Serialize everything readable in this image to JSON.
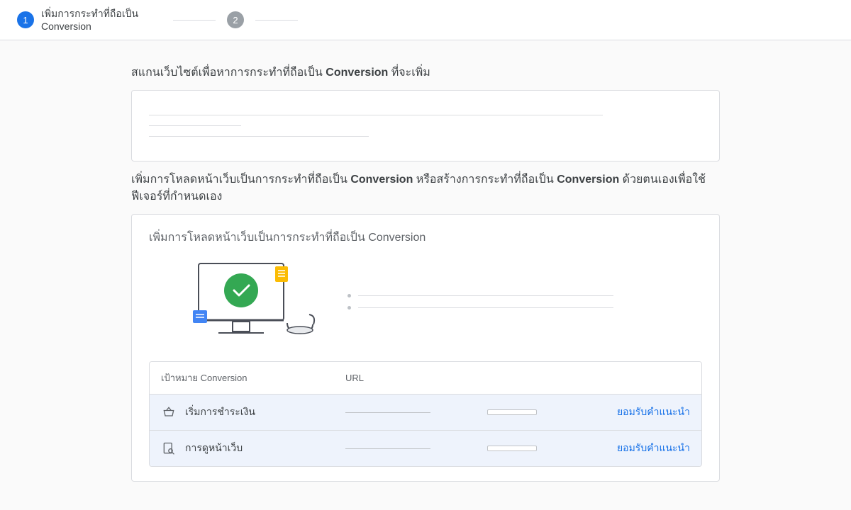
{
  "stepper": {
    "step1": {
      "number": "1",
      "label": "เพิ่มการกระทำที่ถือเป็น Conversion"
    },
    "step2": {
      "number": "2"
    }
  },
  "section1": {
    "heading_prefix": "สแกนเว็บไซต์เพื่อหาการกระทำที่ถือเป็น ",
    "heading_bold": "Conversion",
    "heading_suffix": " ที่จะเพิ่ม"
  },
  "section2": {
    "heading_prefix": "เพิ่มการโหลดหน้าเว็บเป็นการกระทำที่ถือเป็น ",
    "heading_bold1": "Conversion",
    "heading_mid": " หรือสร้างการกระทำที่ถือเป็น ",
    "heading_bold2": "Conversion",
    "heading_suffix": " ด้วยตนเองเพื่อใช้ฟีเจอร์ที่กำหนดเอง"
  },
  "card": {
    "title": "เพิ่มการโหลดหน้าเว็บเป็นการกระทำที่ถือเป็น Conversion"
  },
  "table": {
    "headers": {
      "goal": "เป้าหมาย Conversion",
      "url": "URL"
    },
    "rows": [
      {
        "icon": "basket",
        "label": "เริ่มการชำระเงิน",
        "action": "ยอมรับคำแนะนำ"
      },
      {
        "icon": "page-search",
        "label": "การดูหน้าเว็บ",
        "action": "ยอมรับคำแนะนำ"
      }
    ]
  }
}
